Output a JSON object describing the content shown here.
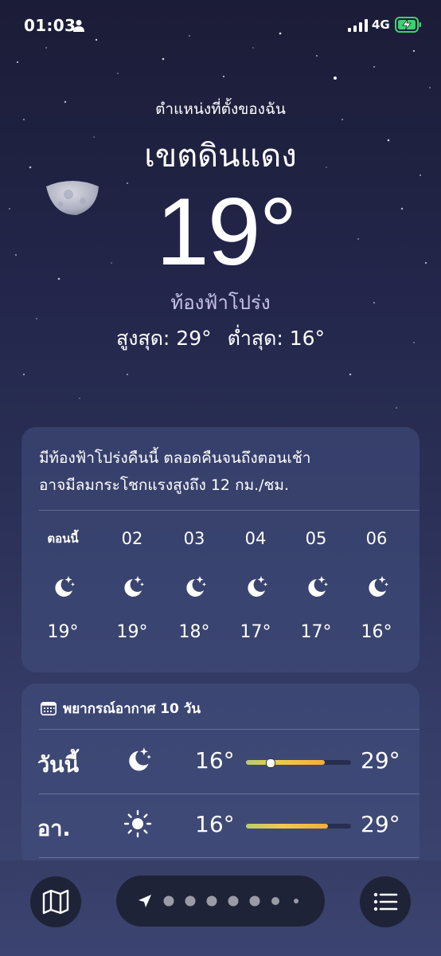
{
  "status_bar": {
    "time": "01:03",
    "network": "4G",
    "icons": [
      "person-icon",
      "signal-icon",
      "battery-charging-icon"
    ]
  },
  "header": {
    "location_label": "ตำแหน่งที่ตั้งของฉัน",
    "city": "เขตดินแดง",
    "temperature": "19°",
    "condition": "ท้องฟ้าโปร่ง",
    "high": "สูงสุด: 29°",
    "low": "ต่ำสุด: 16°"
  },
  "hourly": {
    "summary_line1": "มีท้องฟ้าโปร่งคืนนี้ ตลอดคืนจนถึงตอนเช้า",
    "summary_line2": "อาจมีลมกระโชกแรงสูงถึง 12 กม./ชม.",
    "hours": [
      {
        "label": "ตอนนี้",
        "icon": "moon-stars-icon",
        "temp": "19°"
      },
      {
        "label": "02",
        "icon": "moon-stars-icon",
        "temp": "19°"
      },
      {
        "label": "03",
        "icon": "moon-stars-icon",
        "temp": "18°"
      },
      {
        "label": "04",
        "icon": "moon-stars-icon",
        "temp": "17°"
      },
      {
        "label": "05",
        "icon": "moon-stars-icon",
        "temp": "17°"
      },
      {
        "label": "06",
        "icon": "moon-stars-icon",
        "temp": "16°"
      }
    ]
  },
  "forecast": {
    "title": "พยากรณ์อากาศ 10 วัน",
    "title_icon": "calendar-icon",
    "days": [
      {
        "day": "วันนี้",
        "icon": "moon-stars-icon",
        "low": "16°",
        "high": "29°",
        "range_start": 0.0,
        "range_end": 0.75,
        "current_fraction": 0.23
      },
      {
        "day": "อา.",
        "icon": "sun-icon",
        "low": "16°",
        "high": "29°",
        "range_start": 0.0,
        "range_end": 0.78
      }
    ]
  },
  "toolbar": {
    "map_icon": "map-icon",
    "list_icon": "list-icon",
    "page_count": 7,
    "current_page": 0
  },
  "colors": {
    "background_top": "#1b1c37",
    "background_bottom": "#3e4673",
    "card": "#44507f",
    "condition_text": "#c7c2e8",
    "range_gradient_start": "#b8cf6a",
    "range_gradient_end": "#f2ae3a"
  }
}
